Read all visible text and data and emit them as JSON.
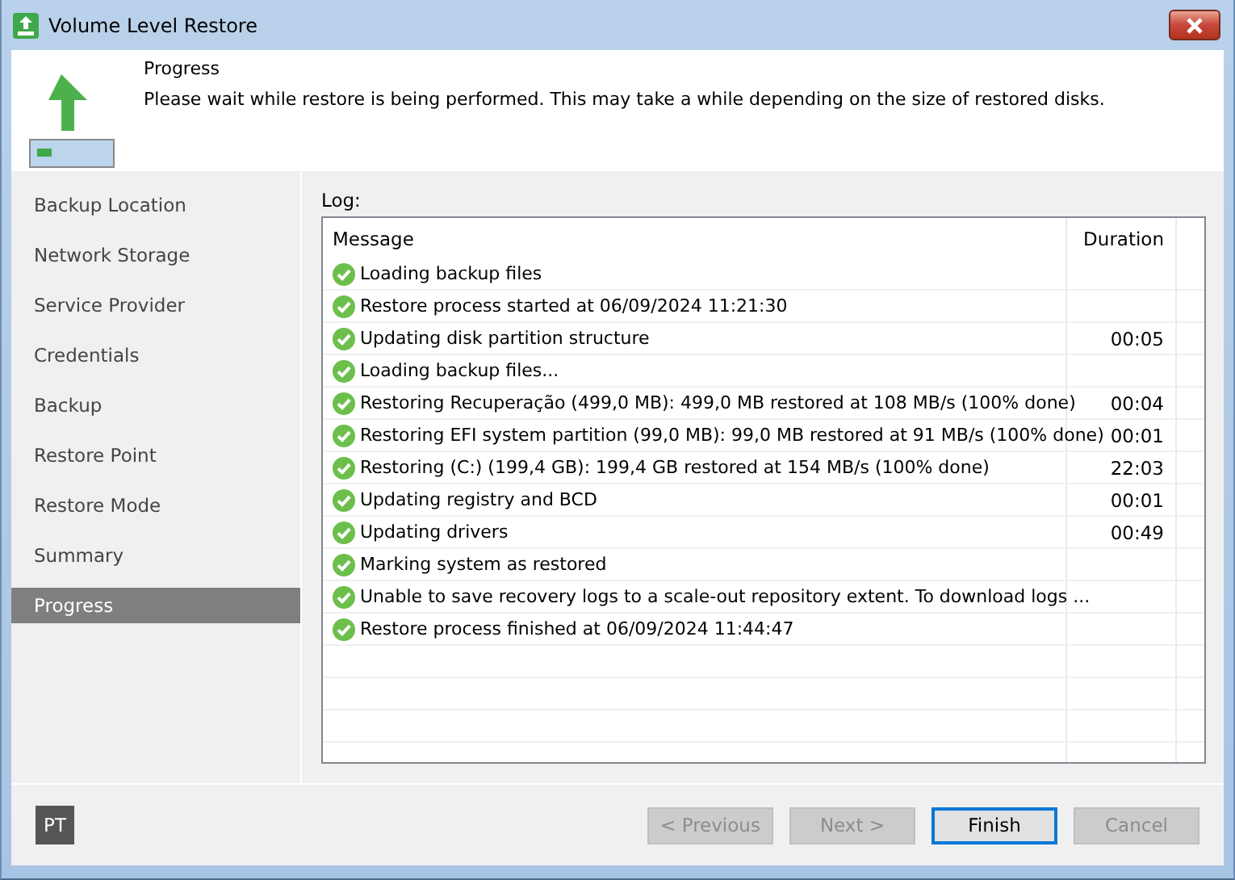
{
  "window": {
    "title": "Volume Level Restore"
  },
  "header": {
    "title": "Progress",
    "description": "Please wait while restore is being performed. This may take a while depending on the size of restored disks."
  },
  "sidebar": {
    "items": [
      {
        "label": "Backup Location",
        "selected": false
      },
      {
        "label": "Network Storage",
        "selected": false
      },
      {
        "label": "Service Provider",
        "selected": false
      },
      {
        "label": "Credentials",
        "selected": false
      },
      {
        "label": "Backup",
        "selected": false
      },
      {
        "label": "Restore Point",
        "selected": false
      },
      {
        "label": "Restore Mode",
        "selected": false
      },
      {
        "label": "Summary",
        "selected": false
      },
      {
        "label": "Progress",
        "selected": true
      }
    ]
  },
  "log": {
    "label": "Log:",
    "columns": [
      "Message",
      "Duration"
    ],
    "rows": [
      {
        "kind": "success",
        "message": "Loading backup files"
      },
      {
        "kind": "success",
        "message": "Restore process started at 06/09/2024 11:21:30"
      },
      {
        "kind": "success",
        "message": "Updating disk partition structure",
        "duration": "00:05"
      },
      {
        "kind": "success",
        "message": "Loading backup files..."
      },
      {
        "kind": "success",
        "message": "Restoring Recuperação (499,0 MB): 499,0 MB restored at 108 MB/s (100% done)",
        "duration": "00:04"
      },
      {
        "kind": "success",
        "message": "Restoring EFI system partition (99,0 MB): 99,0 MB restored at 91 MB/s (100% done)",
        "duration": "00:01"
      },
      {
        "kind": "success",
        "message": "Restoring (C:) (199,4 GB): 199,4 GB restored at 154 MB/s (100% done)",
        "duration": "22:03"
      },
      {
        "kind": "success",
        "message": "Updating registry and BCD",
        "duration": "00:01"
      },
      {
        "kind": "success",
        "message": "Updating drivers",
        "duration": "00:49"
      },
      {
        "kind": "success",
        "message": "Marking system as restored"
      },
      {
        "kind": "success",
        "message": "Unable to save recovery logs to a scale-out repository extent. To download logs ..."
      },
      {
        "kind": "success",
        "message": "Restore process finished at 06/09/2024 11:44:47"
      }
    ]
  },
  "footer": {
    "badge": "PT",
    "buttons": [
      {
        "label": "< Previous",
        "disabled": true,
        "default": false
      },
      {
        "label": "Next >",
        "disabled": true,
        "default": false
      },
      {
        "label": "Finish",
        "disabled": false,
        "default": true
      },
      {
        "label": "Cancel",
        "disabled": true,
        "default": false
      }
    ]
  }
}
